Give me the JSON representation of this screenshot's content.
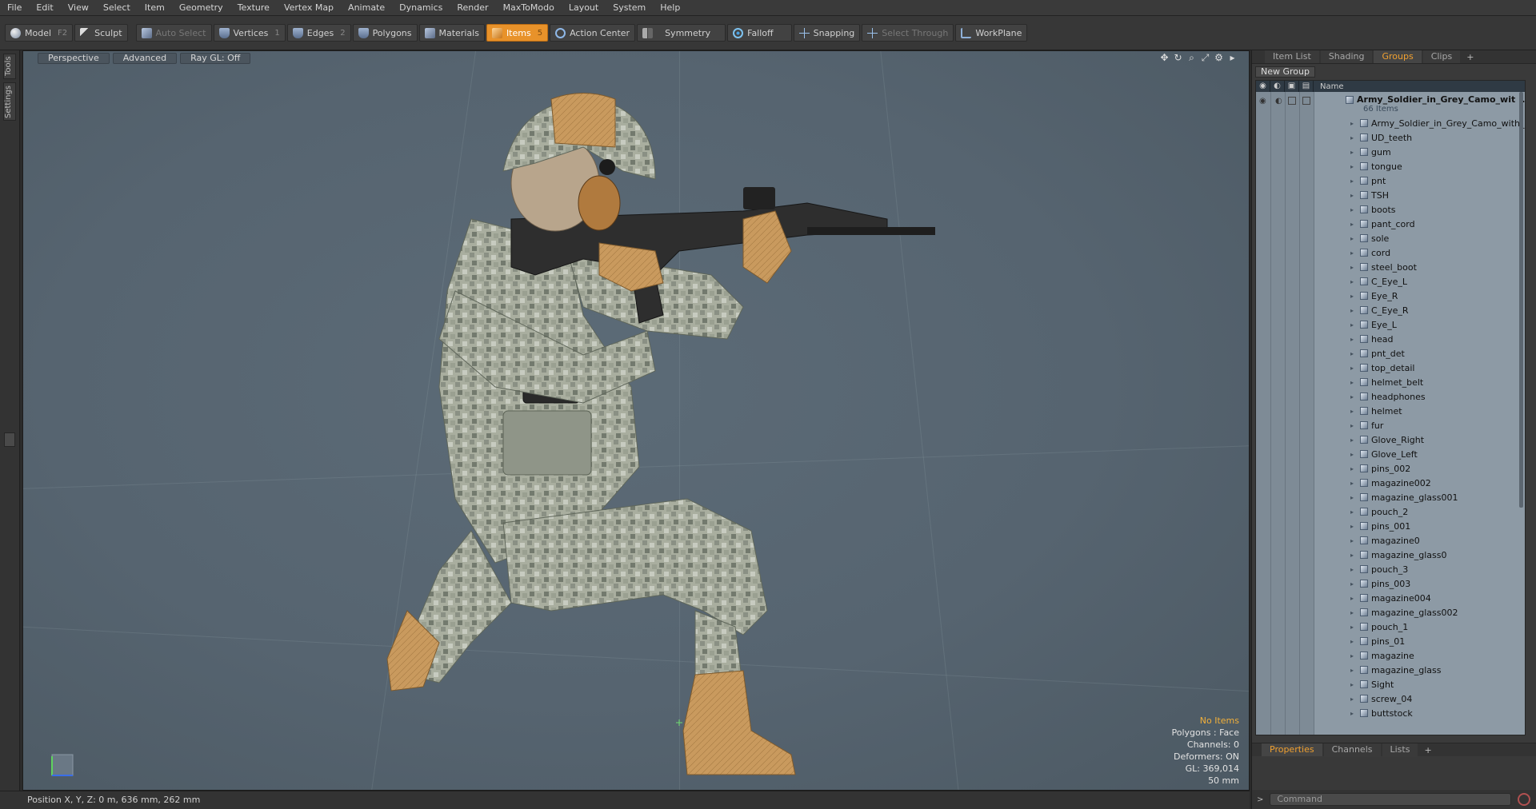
{
  "menu": [
    "File",
    "Edit",
    "View",
    "Select",
    "Item",
    "Geometry",
    "Texture",
    "Vertex Map",
    "Animate",
    "Dynamics",
    "Render",
    "MaxToModo",
    "Layout",
    "System",
    "Help"
  ],
  "toolbar": {
    "model": "Model",
    "model_key": "F2",
    "sculpt": "Sculpt",
    "auto_select": "Auto Select",
    "vertices": "Vertices",
    "vertices_key": "1",
    "edges": "Edges",
    "edges_key": "2",
    "polygons": "Polygons",
    "materials": "Materials",
    "items": "Items",
    "items_key": "5",
    "action_center": "Action Center",
    "symmetry": "Symmetry",
    "falloff": "Falloff",
    "snapping": "Snapping",
    "select_through": "Select Through",
    "workplane": "WorkPlane"
  },
  "left_tabs": {
    "tools": "Tools",
    "settings": "Settings"
  },
  "viewport": {
    "perspective": "Perspective",
    "advanced": "Advanced",
    "raygl": "Ray GL: Off",
    "info": {
      "no_items": "No Items",
      "polygons": "Polygons : Face",
      "channels": "Channels: 0",
      "deformers": "Deformers: ON",
      "gl": "GL: 369,014",
      "scale": "50 mm"
    }
  },
  "status": {
    "position": "Position X, Y, Z:   0 m, 636 mm, 262 mm"
  },
  "right_panel": {
    "tabs": [
      "Item List",
      "Shading",
      "Groups",
      "Clips"
    ],
    "active_tab": "Groups",
    "new_group": "New Group",
    "column_name": "Name",
    "root_name": "Army_Soldier_in_Grey_Camo_wit ...",
    "root_count": "66 Items",
    "items": [
      "Army_Soldier_in_Grey_Camo_with_Rif...",
      "UD_teeth",
      "gum",
      "tongue",
      "pnt",
      "TSH",
      "boots",
      "pant_cord",
      "sole",
      "cord",
      "steel_boot",
      "C_Eye_L",
      "Eye_R",
      "C_Eye_R",
      "Eye_L",
      "head",
      "pnt_det",
      "top_detail",
      "helmet_belt",
      "headphones",
      "helmet",
      "fur",
      "Glove_Right",
      "Glove_Left",
      "pins_002",
      "magazine002",
      "magazine_glass001",
      "pouch_2",
      "pins_001",
      "magazine0",
      "magazine_glass0",
      "pouch_3",
      "pins_003",
      "magazine004",
      "magazine_glass002",
      "pouch_1",
      "pins_01",
      "magazine",
      "magazine_glass",
      "Sight",
      "screw_04",
      "buttstock"
    ],
    "bottom_tabs": [
      "Properties",
      "Channels",
      "Lists"
    ],
    "active_bottom_tab": "Properties",
    "command_placeholder": "Command"
  },
  "colors": {
    "accent": "#e8922a",
    "viewport_bg": "#566470",
    "tree_bg": "#8d9aa5"
  }
}
